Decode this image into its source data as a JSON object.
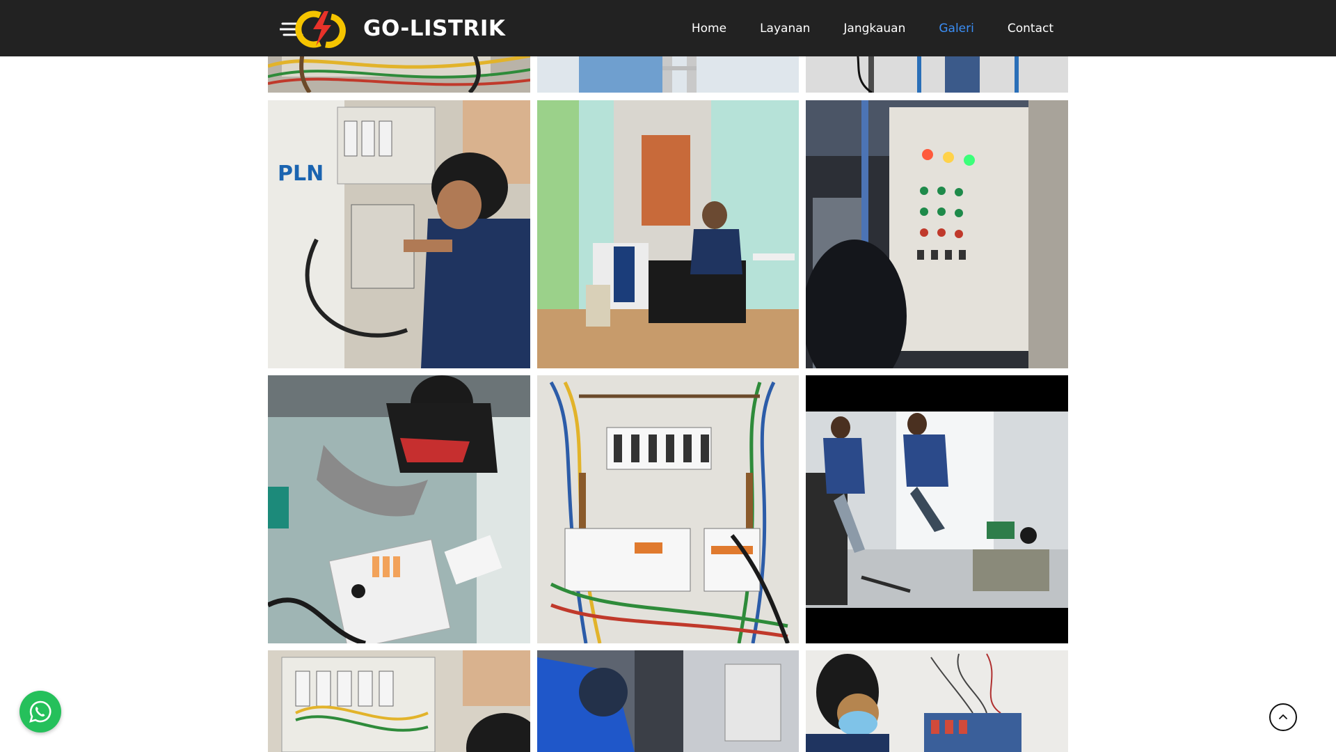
{
  "brand": {
    "name": "GO-LISTRIK",
    "logo_icon": "lightning-bolt-logo",
    "accent_color": "#f5c400",
    "bolt_color": "#e8322a"
  },
  "nav": {
    "items": [
      {
        "label": "Home",
        "active": false
      },
      {
        "label": "Layanan",
        "active": false
      },
      {
        "label": "Jangkauan",
        "active": false
      },
      {
        "label": "Galeri",
        "active": true
      },
      {
        "label": "Contact",
        "active": false
      }
    ],
    "active_color": "#3b8ef5"
  },
  "gallery": {
    "photos": [
      {
        "subject": "electrical panel wiring (top cropped)"
      },
      {
        "subject": "technician on ladder (top cropped)"
      },
      {
        "subject": "technician near wall conduit (top cropped)"
      },
      {
        "subject": "technician working at PLN meter box"
      },
      {
        "subject": "technician seated at desk in office"
      },
      {
        "subject": "control panel with indicator lights"
      },
      {
        "subject": "technician assembling breaker panel"
      },
      {
        "subject": "distribution panel with breakers"
      },
      {
        "subject": "two technicians installing panel (video frame)"
      },
      {
        "subject": "panel wiring with technician (bottom cropped)"
      },
      {
        "subject": "technician in blue uniform at panel (bottom cropped)"
      },
      {
        "subject": "technician with mask at wall box (bottom cropped)"
      }
    ]
  },
  "floating": {
    "whatsapp_icon": "whatsapp-icon",
    "whatsapp_color": "#25c05b",
    "scroll_top_icon": "chevron-up-icon"
  }
}
